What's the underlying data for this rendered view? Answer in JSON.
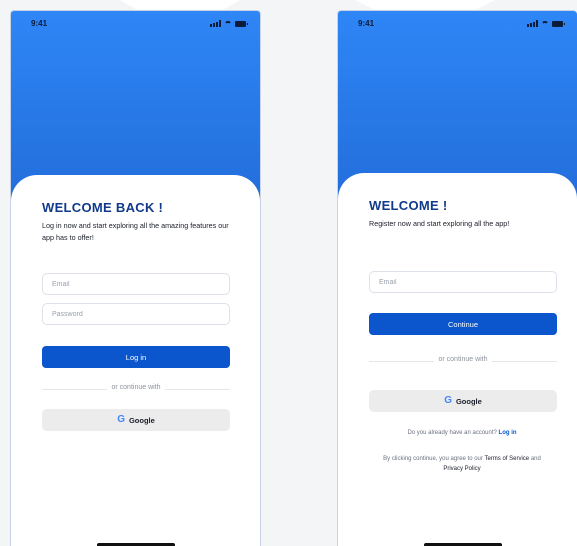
{
  "login": {
    "status_time": "9:41",
    "title": "WELCOME BACK !",
    "subtitle": "Log in now and start exploring all the amazing features our app has to offer!",
    "email_placeholder": "Email",
    "password_placeholder": "Password",
    "login_button": "Log in",
    "divider_text": "or continue with",
    "google_button": "Google"
  },
  "register": {
    "status_time": "9:41",
    "title": "WELCOME !",
    "subtitle": "Register now and start exploring all the app!",
    "email_placeholder": "Email",
    "continue_button": "Continue",
    "divider_text": "or continue with",
    "google_button": "Google",
    "account_prompt": "Do you already have an account?",
    "login_link": "Log in",
    "terms_prefix": "By clicking continue, you agree to our",
    "terms_link": "Terms of Service",
    "terms_and": "and",
    "privacy_link": "Privacy Policy"
  },
  "colors": {
    "primary": "#0b56cc",
    "title": "#103a8c",
    "gradient_top": "#2f86f6",
    "gradient_bottom": "#0d3f9a"
  }
}
